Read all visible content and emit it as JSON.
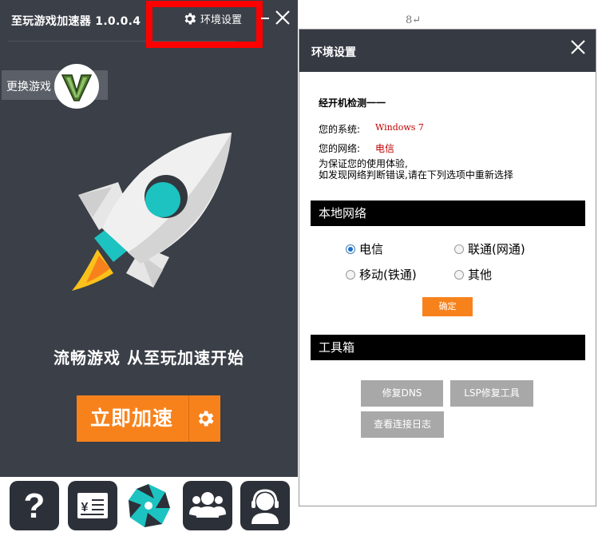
{
  "app": {
    "title": "至玩游戏加速器 1.0.0.4",
    "env_settings_label": "环境设置",
    "change_game_label": "更换游戏",
    "game_logo_text": "V",
    "slogan": "流畅游戏 从至玩加速开始",
    "accelerate_label": "立即加速",
    "bottom_toolbar": [
      "help-icon",
      "yen-card-icon",
      "center-logo-icon",
      "community-icon",
      "customer-service-icon"
    ]
  },
  "page_number": "8↵",
  "dialog": {
    "title": "环境设置",
    "detect_heading": "经开机检测一一",
    "system_label": "您的系统:",
    "system_value": "Windows 7",
    "network_label": "您的网络:",
    "network_value": "电信",
    "hint_line1": "为保证您的使用体验,",
    "hint_line2": "如发现网络判断错误,请在下列选项中重新选择",
    "local_network_title": "本地网络",
    "options": [
      {
        "label": "电信",
        "selected": true
      },
      {
        "label": "联通(网通)",
        "selected": false
      },
      {
        "label": "移动(铁通)",
        "selected": false
      },
      {
        "label": "其他",
        "selected": false
      }
    ],
    "confirm_label": "确定",
    "toolbox_title": "工具箱",
    "tool_buttons": [
      "修复DNS",
      "LSP修复工具",
      "查看连接日志"
    ]
  },
  "colors": {
    "app_bg": "#3a3f48",
    "accent": "#f7821c",
    "highlight": "#ff0000",
    "header_dark": "#353a43",
    "rocket_cyan": "#1cc3c1",
    "red_text": "#c00000"
  }
}
